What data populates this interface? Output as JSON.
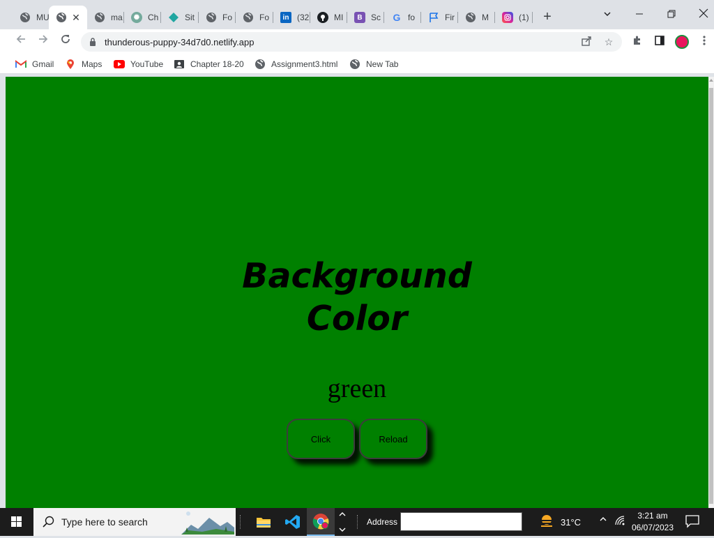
{
  "browser": {
    "tabs": [
      {
        "label": "MU",
        "icon": "globe-icon"
      },
      {
        "label": "",
        "icon": "globe-icon",
        "active": true
      },
      {
        "label": "ma",
        "icon": "globe-icon"
      },
      {
        "label": "Ch",
        "icon": "chatgpt-icon"
      },
      {
        "label": "Sit",
        "icon": "diamond-icon"
      },
      {
        "label": "Fo",
        "icon": "globe-icon"
      },
      {
        "label": "Fo",
        "icon": "globe-icon"
      },
      {
        "label": "(32",
        "icon": "linkedin-icon"
      },
      {
        "label": "MI",
        "icon": "github-icon"
      },
      {
        "label": "Sc",
        "icon": "bootstrap-icon"
      },
      {
        "label": "fo",
        "icon": "google-icon"
      },
      {
        "label": "Fir",
        "icon": "flag-icon"
      },
      {
        "label": "M",
        "icon": "globe-icon"
      },
      {
        "label": "(1)",
        "icon": "instagram-icon"
      }
    ],
    "new_tab_symbol": "+",
    "url": "thunderous-puppy-34d7d0.netlify.app",
    "bookmarks": [
      {
        "label": "Gmail",
        "icon": "gmail-icon"
      },
      {
        "label": "Maps",
        "icon": "maps-icon"
      },
      {
        "label": "YouTube",
        "icon": "youtube-icon"
      },
      {
        "label": "Chapter 18-20",
        "icon": "contact-icon"
      },
      {
        "label": "Assignment3.html",
        "icon": "globe-icon"
      },
      {
        "label": "New Tab",
        "icon": "globe-icon"
      }
    ]
  },
  "page": {
    "background_color": "#008000",
    "heading_line1": "Background",
    "heading_line2": "Color",
    "color_name": "green",
    "click_button": "Click",
    "reload_button": "Reload"
  },
  "taskbar": {
    "search_placeholder": "Type here to search",
    "address_label": "Address",
    "address_value": "",
    "temperature": "31°C",
    "time": "3:21 am",
    "date": "06/07/2023"
  }
}
